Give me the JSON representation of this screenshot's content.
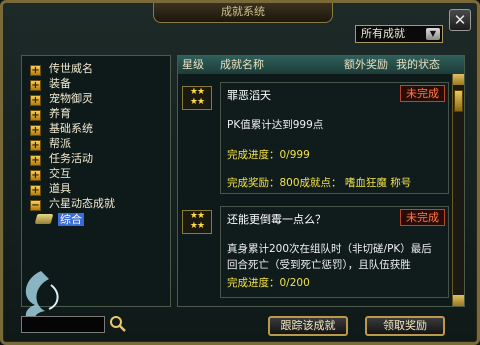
{
  "window": {
    "title": "成就系统",
    "close_glyph": "✕"
  },
  "filter": {
    "selected": "所有成就"
  },
  "tree": {
    "items": [
      "传世威名",
      "装备",
      "宠物御灵",
      "养育",
      "基础系统",
      "帮派",
      "任务活动",
      "交互",
      "道具",
      "六星动态成就"
    ],
    "selected_sub": "综合"
  },
  "table": {
    "headers": {
      "stars": "星级",
      "name": "成就名称",
      "bonus": "额外奖励",
      "status": "我的状态"
    }
  },
  "achievements": [
    {
      "title": "罪恶滔天",
      "status": "未完成",
      "lines": [
        {
          "text": "PK值累计达到999点",
          "color": "white"
        },
        {
          "text": "完成进度：0/999",
          "color": "yellow"
        },
        {
          "text": "完成奖励：800成就点： 嗜血狂魔 称号",
          "color": "yellow"
        }
      ]
    },
    {
      "title": "还能更倒霉一点么？",
      "status": "未完成",
      "lines": [
        {
          "text": "真身累计200次在组队时（非切磋/PK）最后",
          "color": "white"
        },
        {
          "text": "回合死亡（受到死亡惩罚），且队伍获胜",
          "color": "white"
        },
        {
          "text": "完成进度：0/200",
          "color": "yellow"
        }
      ]
    }
  ],
  "buttons": {
    "track": "跟踪该成就",
    "claim": "领取奖励"
  },
  "colors": {
    "frame": "#7a6a3a",
    "accent_yellow": "#f2e24a",
    "status_red": "#ff7a4a"
  }
}
